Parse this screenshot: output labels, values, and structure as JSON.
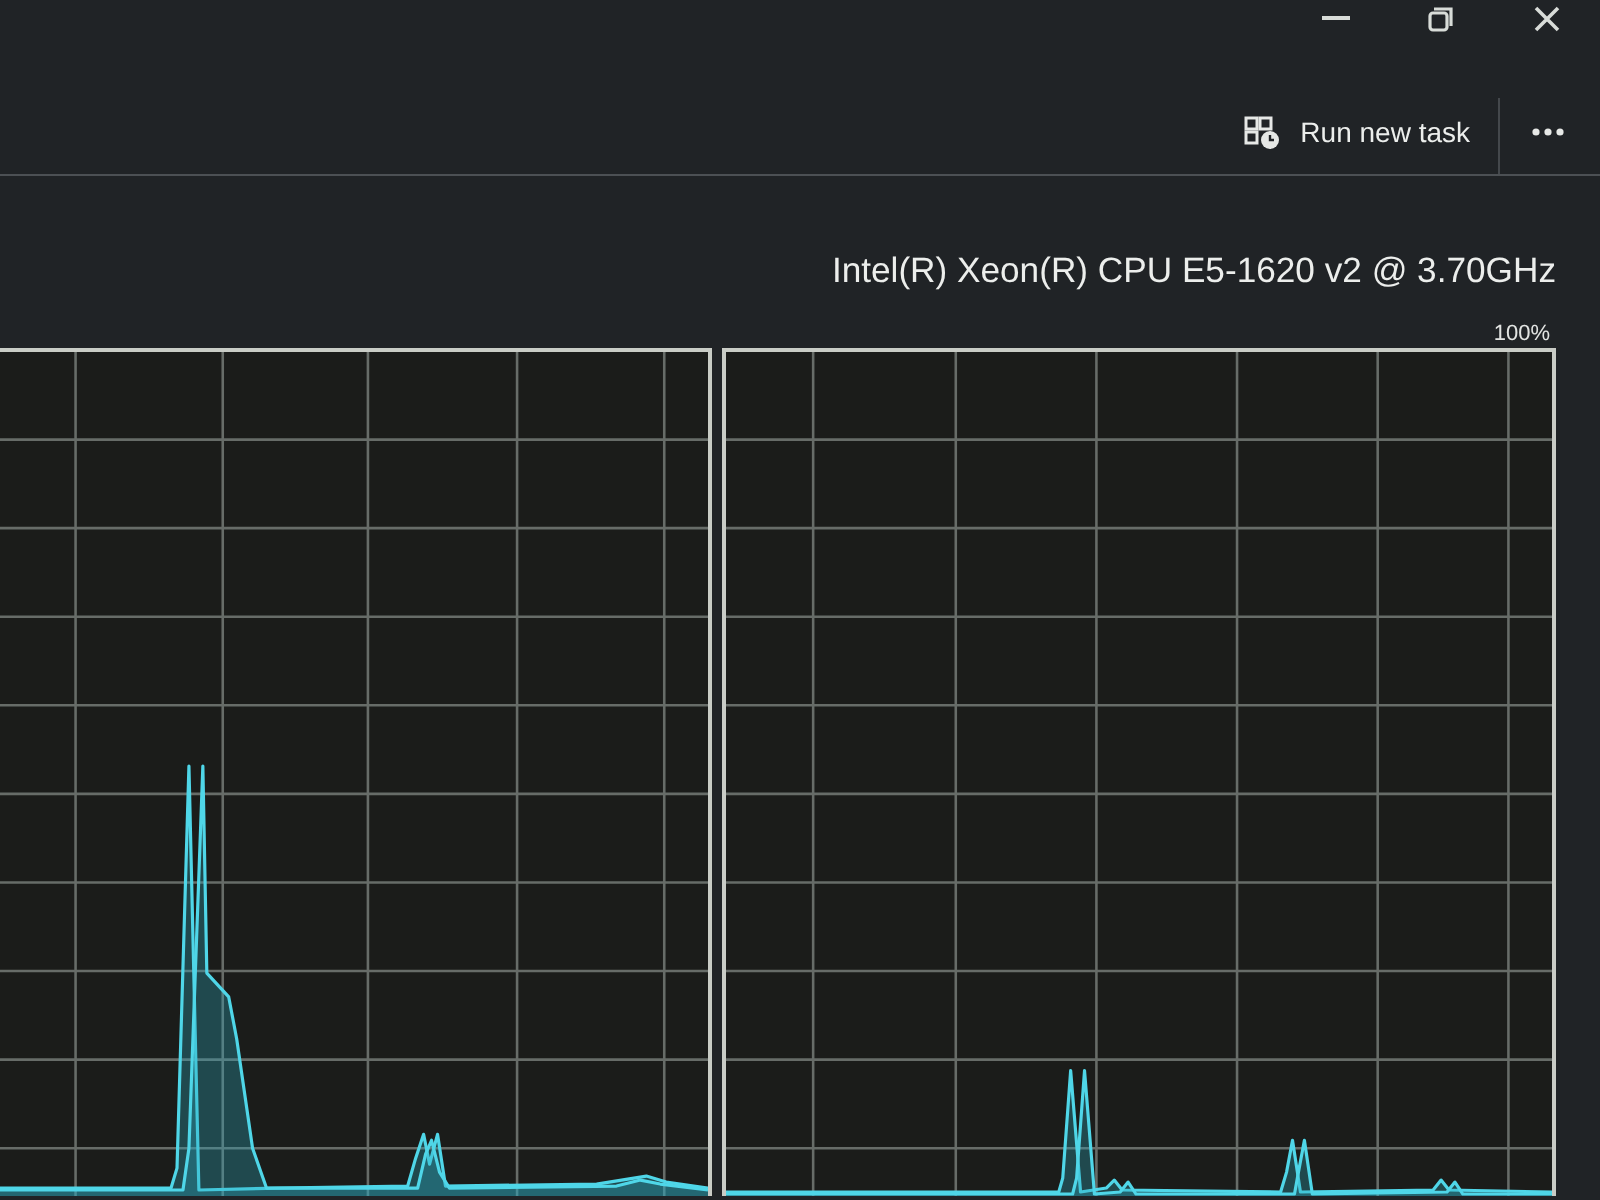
{
  "window": {
    "controls": [
      {
        "kind": "minimize"
      },
      {
        "kind": "restore"
      },
      {
        "kind": "close"
      }
    ]
  },
  "toolbar": {
    "buttons": [
      {
        "kind": "run",
        "label": "Run new task"
      },
      {
        "kind": "more"
      }
    ]
  },
  "cpu": {
    "name": "Intel(R) Xeon(R) CPU E5-1620 v2 @ 3.70GHz",
    "scale_max": "100%"
  },
  "graphs": [
    {
      "kind": "cpu_usage"
    },
    {
      "kind": "cpu_usage"
    }
  ]
}
